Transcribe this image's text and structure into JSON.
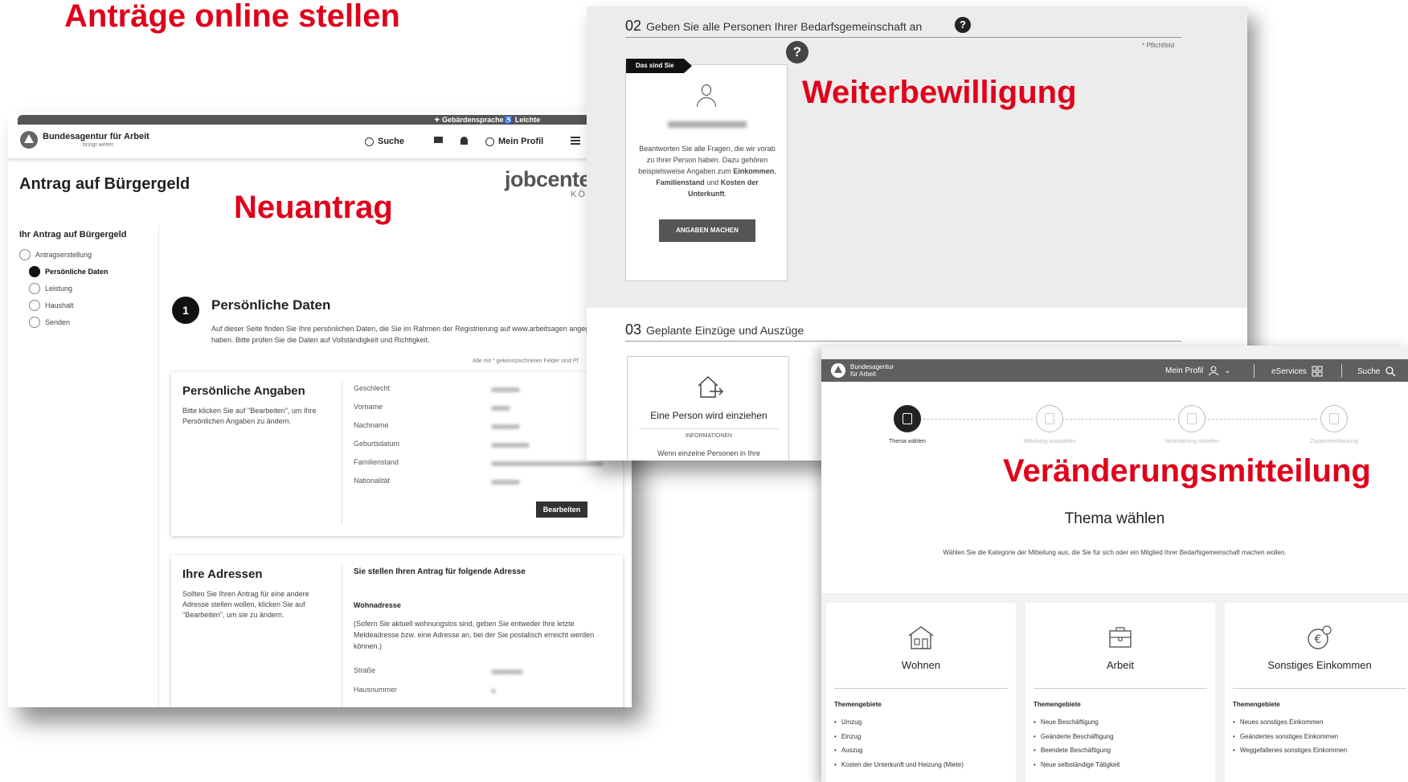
{
  "slide": {
    "title": "Anträge online stellen",
    "label_neuantrag": "Neuantrag",
    "label_weiterbewilligung": "Weiterbewilligung",
    "label_veraenderung": "Veränderungsmitteilung"
  },
  "neuantrag": {
    "topbar": {
      "sign_language": "Gebärdensprache",
      "easy_language": "Leichte"
    },
    "brand": {
      "name": "Bundesagentur für Arbeit",
      "tagline": "bringt weiter."
    },
    "nav": {
      "search": "Suche",
      "profile": "Mein Profil"
    },
    "jobcenter": "jobcente",
    "jobcenter_city": "KÖ",
    "page_title": "Antrag auf Bürgergeld",
    "sidebar": {
      "title": "Ihr Antrag auf Bürgergeld",
      "steps": [
        "Antragserstellung",
        "Persönliche Daten",
        "Leistung",
        "Haushalt",
        "Senden"
      ]
    },
    "section": {
      "number": "1",
      "title": "Persönliche Daten",
      "text": "Auf dieser Seite finden Sie Ihre persönlichen Daten, die Sie im Rahmen der Registrierung auf www.arbeitsagen angegeben haben. Bitte prüfen Sie die Daten auf Vollständigkeit und Richtigkeit.",
      "required_note": "Alle mit * gekennzeichneten Felder sind Pf"
    },
    "personal_card": {
      "title": "Persönliche Angaben",
      "text": "Bitte klicken Sie auf \"Bearbeiten\", um Ihre Persönlichen Angaben zu ändern.",
      "fields": [
        "Geschlecht",
        "Vorname",
        "Nachname",
        "Geburtsdatum",
        "Familienstand",
        "Nationalität"
      ],
      "edit_button": "Bearbeiten"
    },
    "address_card": {
      "title": "Ihre Adressen",
      "text": "Sollten Sie Ihren Antrag für eine andere Adresse stellen wollen, klicken Sie auf \"Bearbeiten\", um sie zu ändern.",
      "heading": "Sie stellen Ihren Antrag für folgende Adresse",
      "subheading": "Wohnadresse",
      "paragraph": "(Sofern Sie aktuell wohnungslos sind, geben Sie entweder Ihre letzte Meldeadresse bzw. eine Adresse an, bei der Sie postalisch erreicht werden können.)",
      "fields": [
        "Straße",
        "Hausnummer"
      ]
    }
  },
  "weiterbewilligung": {
    "section2": {
      "number": "02",
      "title": "Geben Sie alle Personen Ihrer Bedarfsgemeinschaft an"
    },
    "required": "* Pflichtfeld",
    "person_card": {
      "tag": "Das sind Sie",
      "text_1": "Beantworten Sie alle Fragen, die wir vorab zu Ihrer Person haben. Dazu gehören beispielsweise Angaben zum ",
      "bold_1": "Einkommen",
      "sep_1": ", ",
      "bold_2": "Familienstand",
      "sep_2": " und ",
      "bold_3": "Kosten der Unterkunft",
      "end": ".",
      "button": "ANGABEN MACHEN"
    },
    "section3": {
      "number": "03",
      "title": "Geplante Einzüge und Auszüge"
    },
    "move_card": {
      "title": "Eine Person wird einziehen",
      "info": "INFORMATIONEN",
      "text": "Wenn einzelne Personen in Ihre"
    }
  },
  "veraenderung": {
    "brand": "Bundesagentur für Arbeit",
    "nav": {
      "profile": "Mein Profil",
      "eservices": "eServices",
      "search": "Suche"
    },
    "steps": [
      "Thema wählen",
      "Mitteilung auswählen",
      "Veränderung mitteilen",
      "Zusammenfassung"
    ],
    "heading": "Thema wählen",
    "description": "Wählen Sie die Kategorie der Mitteilung aus, die Sie für sich oder ein Mitglied Ihrer Bedarfsgemeinschaft machen wollen.",
    "themes_label": "Themengebiete",
    "cards": [
      {
        "title": "Wohnen",
        "icon": "house-icon",
        "items": [
          "Umzug",
          "Einzug",
          "Auszug",
          "Kosten der Unterkunft und Heizung (Miete)"
        ]
      },
      {
        "title": "Arbeit",
        "icon": "briefcase-icon",
        "items": [
          "Neue Beschäftigung",
          "Geänderte Beschäftigung",
          "Beendete Beschäftigung",
          "Neue selbständige Tätigkeit"
        ]
      },
      {
        "title": "Sonstiges Einkommen",
        "icon": "euro-icon",
        "items": [
          "Neues sonstiges Einkommen",
          "Geändertes sonstiges Einkommen",
          "Weggefallenes sonstiges Einkommen"
        ]
      }
    ]
  }
}
